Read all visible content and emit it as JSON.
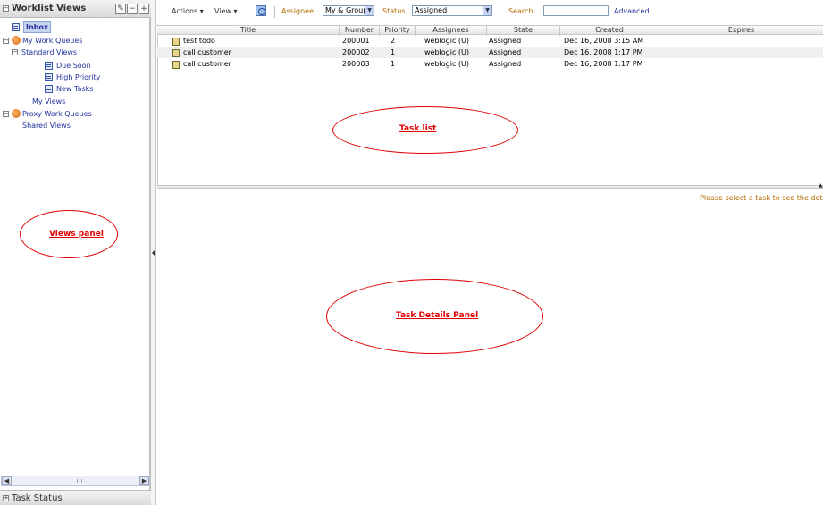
{
  "views_panel": {
    "title": "Worklist Views",
    "header_buttons": [
      "edit",
      "minus",
      "plus"
    ],
    "tree": {
      "inbox": "Inbox",
      "my_work_queues": "My Work Queues",
      "standard_views": "Standard Views",
      "due_soon": "Due Soon",
      "high_priority": "High Priority",
      "new_tasks": "New Tasks",
      "my_views": "My Views",
      "proxy_work_queues": "Proxy Work Queues",
      "shared_views": "Shared Views"
    },
    "footer_label": "Task Status"
  },
  "toolbar": {
    "actions_label": "Actions",
    "view_label": "View",
    "assignee_label": "Assignee",
    "assignee_value": "My & Group",
    "status_label": "Status",
    "status_value": "Assigned",
    "search_label": "Search",
    "search_value": "",
    "advanced_label": "Advanced"
  },
  "task_table": {
    "columns": [
      "Title",
      "Number",
      "Priority",
      "Assignees",
      "State",
      "Created",
      "Expires"
    ],
    "rows": [
      {
        "title": "test todo",
        "number": "200001",
        "priority": "2",
        "assignees": "weblogic (U)",
        "state": "Assigned",
        "created": "Dec 16, 2008 3:15 AM",
        "expires": ""
      },
      {
        "title": "call customer",
        "number": "200002",
        "priority": "1",
        "assignees": "weblogic (U)",
        "state": "Assigned",
        "created": "Dec 16, 2008 1:17 PM",
        "expires": ""
      },
      {
        "title": "call customer",
        "number": "200003",
        "priority": "1",
        "assignees": "weblogic (U)",
        "state": "Assigned",
        "created": "Dec 16, 2008 1:17 PM",
        "expires": ""
      }
    ]
  },
  "details_panel": {
    "message": "Please select a task to see the detai"
  },
  "annotations": {
    "task_list": "Task list",
    "views_panel": "Views panel",
    "task_details": "Task Details Panel"
  },
  "colors": {
    "annotation_red": "#e00000",
    "link_blue": "#22319c",
    "orange_label": "#b36b00"
  }
}
